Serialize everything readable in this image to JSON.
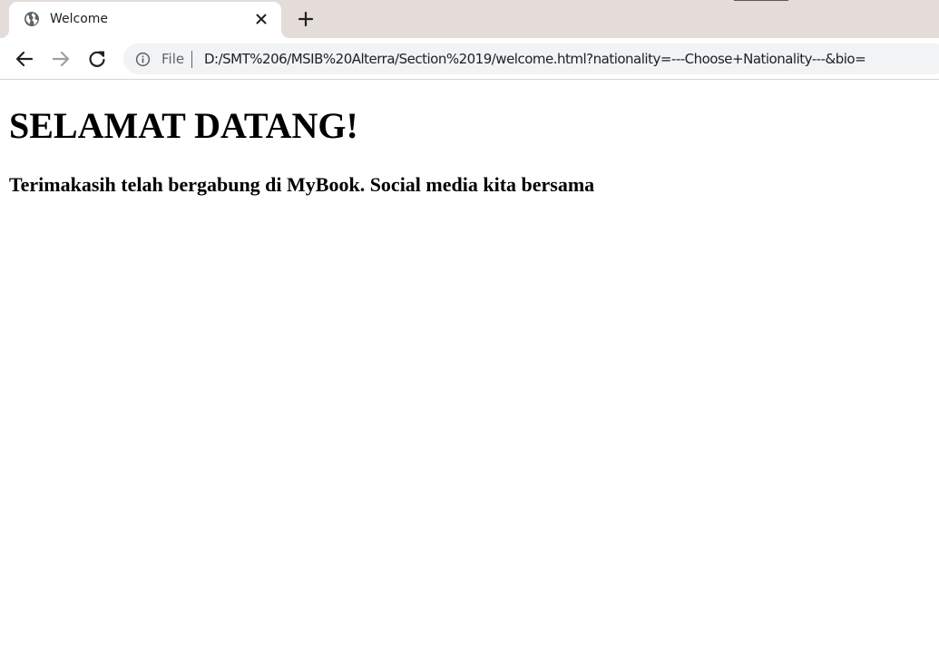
{
  "browser": {
    "tab": {
      "title": "Welcome",
      "favicon": "globe-icon"
    },
    "new_tab_icon": "plus-icon",
    "toolbar": {
      "back_icon": "arrow-left-icon",
      "forward_icon": "arrow-right-icon",
      "reload_icon": "reload-icon"
    },
    "address_bar": {
      "info_icon": "info-icon",
      "scheme_label": "File",
      "url": "D:/SMT%206/MSIB%20Alterra/Section%2019/welcome.html?nationality=---Choose+Nationality---&bio="
    }
  },
  "page": {
    "heading": "SELAMAT DATANG!",
    "subheading": "Terimakasih telah bergabung di MyBook. Social media kita bersama"
  },
  "colors": {
    "tabstrip_bg": "#e3dcd9",
    "omnibox_bg": "#f1f3f4",
    "icon_gray": "#5f6368",
    "text_dark": "#202124"
  }
}
